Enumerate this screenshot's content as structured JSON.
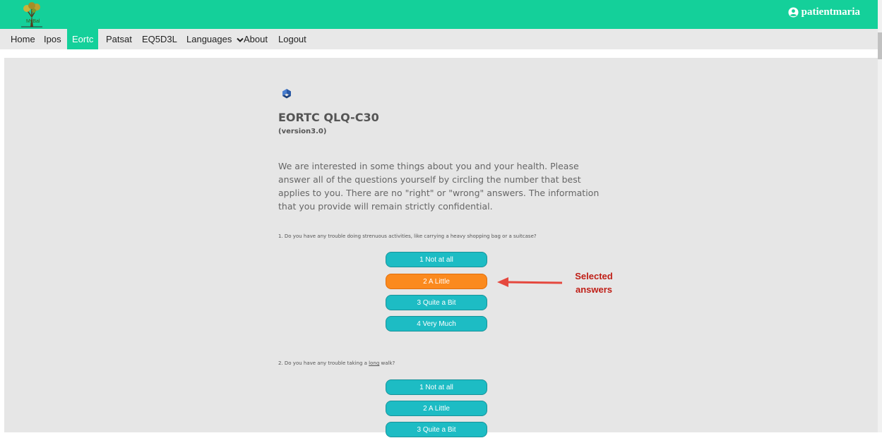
{
  "header": {
    "logo_text": "MyBal",
    "user_label": "patientmaria",
    "user_icon": "user-circle-icon",
    "brand_color": "#14d09a"
  },
  "nav": {
    "items": [
      {
        "label": "Home"
      },
      {
        "label": "Ipos"
      },
      {
        "label": "Eortc"
      },
      {
        "label": "Patsat"
      },
      {
        "label": "EQ5D3L"
      },
      {
        "label": "Languages"
      },
      {
        "label": "About"
      },
      {
        "label": "Logout"
      }
    ],
    "active": "Eortc"
  },
  "form": {
    "title": "EORTC QLQ-C30",
    "version": "(version3.0)",
    "intro": "We are interested in some things about you and your health. Please answer all of the questions yourself by circling the number that best applies to you. There are no \"right\" or \"wrong\" answers. The information that you provide will remain strictly confidential."
  },
  "questions": [
    {
      "text": "1. Do you have any trouble doing strenuous activities, like carrying a heavy shopping bag or a suitcase?",
      "answers": [
        "1 Not at all",
        "2 A Little",
        "3 Quite a Bit",
        "4 Very Much"
      ],
      "selected": "2 A Little"
    },
    {
      "text_before": "2. Do you have any trouble taking a ",
      "text_underlined": "long",
      "text_after": " walk?",
      "answers": [
        "1 Not at all",
        "2 A Little",
        "3 Quite a Bit"
      ]
    }
  ],
  "annotation": {
    "line1": "Selected",
    "line2": "answers",
    "color": "#bf1e16"
  },
  "colors": {
    "answer": "#1dbcc4",
    "selected_answer": "#fb8a1e"
  }
}
